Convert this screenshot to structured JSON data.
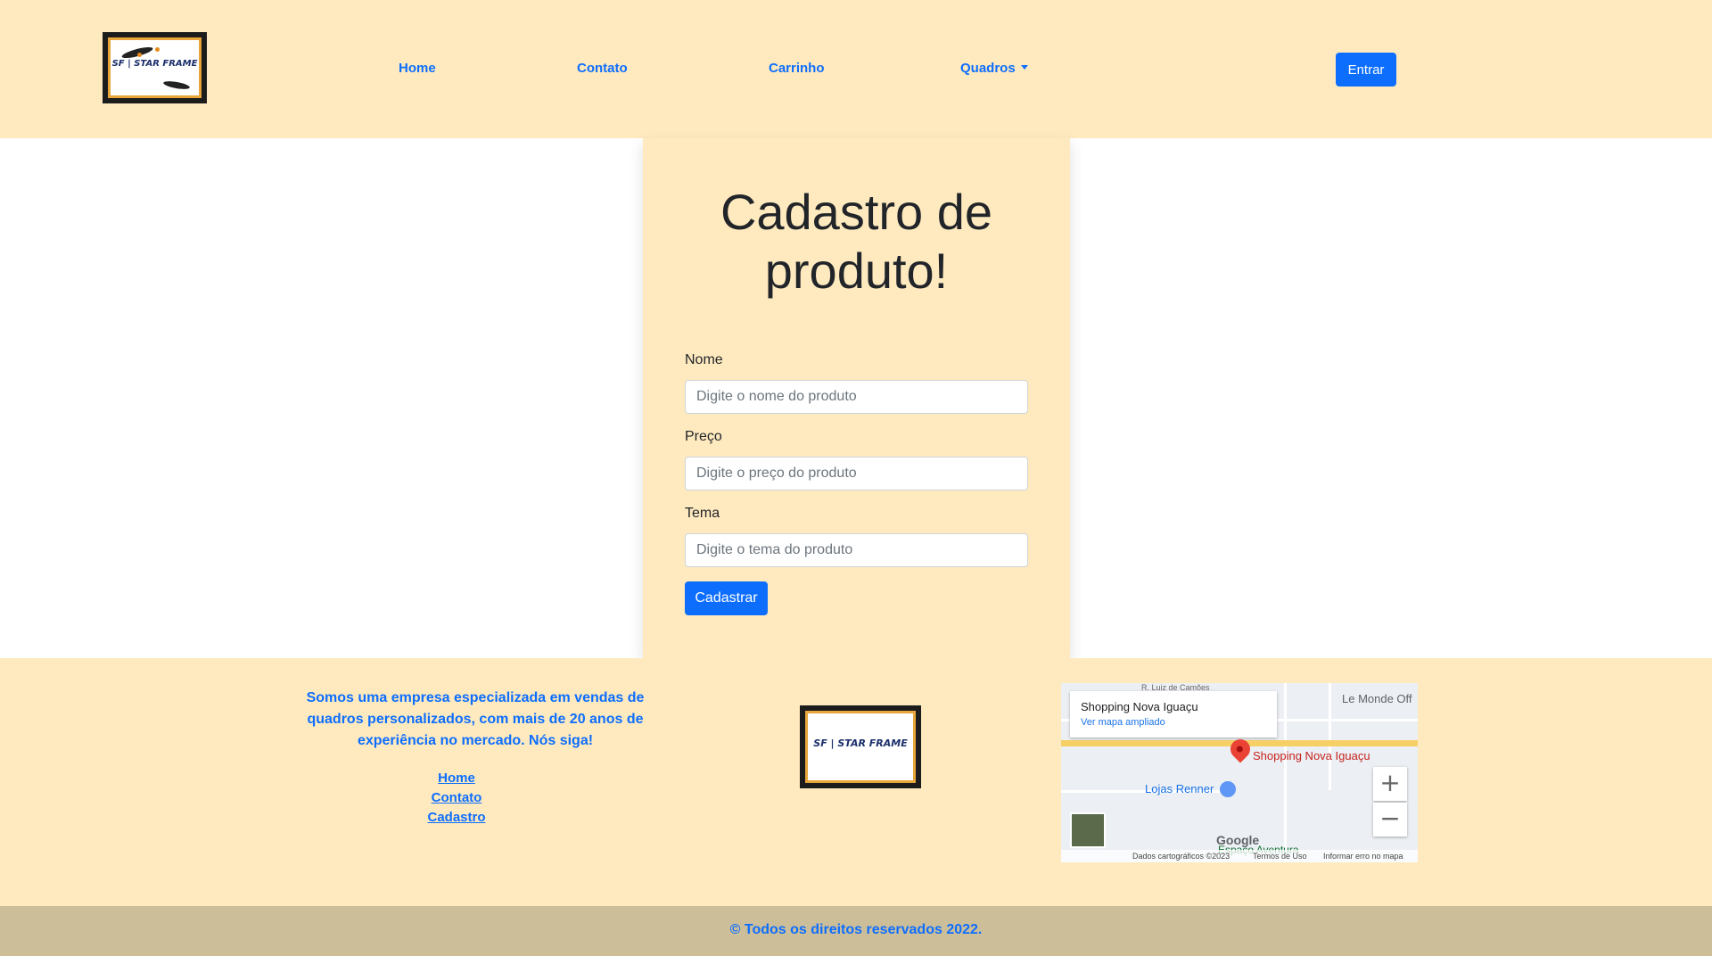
{
  "header": {
    "logo_text": "SF | STAR FRAME",
    "nav": [
      "Home",
      "Contato",
      "Carrinho",
      "Quadros"
    ],
    "login_button": "Entrar"
  },
  "form": {
    "title": "Cadastro de produto!",
    "fields": [
      {
        "label": "Nome",
        "placeholder": "Digite o nome do produto"
      },
      {
        "label": "Preço",
        "placeholder": "Digite o preço do produto"
      },
      {
        "label": "Tema",
        "placeholder": "Digite o tema do produto"
      }
    ],
    "submit": "Cadastrar"
  },
  "footer": {
    "about": "Somos uma empresa especializada em vendas de quadros personalizados, com mais de 20 anos de experiência no mercado. Nós siga!",
    "links": [
      "Home",
      "Contato",
      "Cadastro"
    ],
    "logo_text": "SF | STAR FRAME"
  },
  "map": {
    "place_name": "Shopping Nova Iguaçu",
    "enlarge_link": "Ver mapa ampliado",
    "pin_label": "Shopping Nova Iguaçu",
    "poi_label": "Lojas Renner",
    "area_label": "Espaço Aventura",
    "street1": "R. Luiz de Camões",
    "street2": "Le Monde Off",
    "zoom_in": "+",
    "zoom_out": "−",
    "brand": "Google",
    "map_data": "Dados cartográficos ©2023",
    "terms": "Termos de Uso",
    "report": "Informar erro no mapa"
  },
  "copyright": "© Todos os direitos reservados 2022."
}
